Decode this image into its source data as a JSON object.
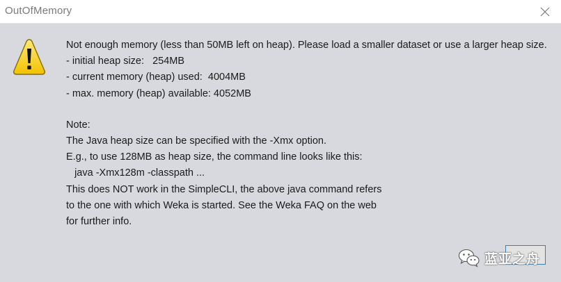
{
  "window": {
    "title": "OutOfMemory",
    "close_icon": "close-icon"
  },
  "icon": {
    "name": "warning-icon",
    "color": "#f5d21a"
  },
  "message": {
    "line1": "Not enough memory (less than 50MB left on heap). Please load a smaller dataset or use a larger heap size.",
    "line2": "- initial heap size:   254MB",
    "line3": "- current memory (heap) used:  4004MB",
    "line4": "- max. memory (heap) available: 4052MB",
    "line5": "Note:",
    "line6": "The Java heap size can be specified with the -Xmx option.",
    "line7": "E.g., to use 128MB as heap size, the command line looks like this:",
    "line8": "   java -Xmx128m -classpath ...",
    "line9": "This does NOT work in the SimpleCLI, the above java command refers",
    "line10": "to the one with which Weka is started. See the Weka FAQ on the web",
    "line11": "for further info."
  },
  "buttons": {
    "ok_label": ""
  },
  "watermark": {
    "text": "蓝亚之舟",
    "icon": "wechat-icon"
  }
}
